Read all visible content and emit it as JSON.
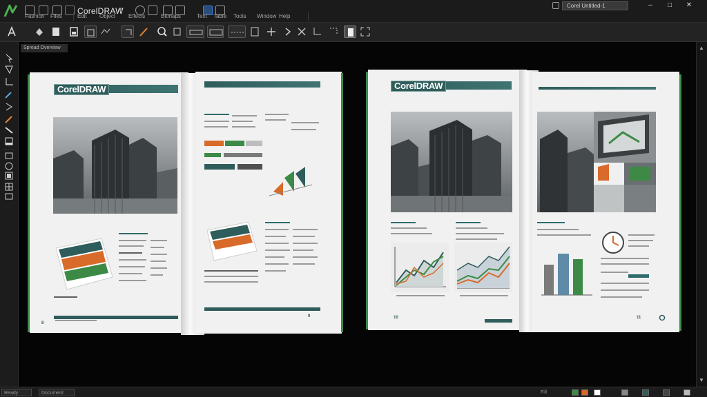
{
  "menubar": {
    "app_title": "CorelDRAW",
    "document_tab": "Corel Untitled-1",
    "menus": [
      "Fashion",
      "Files",
      "Edit",
      "Object",
      "Effects",
      "Bitmaps",
      "Text",
      "Table",
      "Tools",
      "Window",
      "Help"
    ]
  },
  "workspace": {
    "document_label": "Spread Overview"
  },
  "spreads": {
    "left": {
      "logo": "CorelDRAW",
      "page_number_left": "8",
      "page_number_right": "9"
    },
    "right": {
      "logo": "CorelDRAW",
      "page_number_left": "10",
      "page_number_right": "11"
    }
  },
  "statusbar": {
    "left_text": "Ready",
    "middle_text": "Document Info",
    "right_text": "Fill"
  },
  "colors": {
    "accent_teal": "#2f5d5c",
    "accent_green": "#3c8a46",
    "accent_orange": "#d86a2a",
    "chrome_dark": "#1b1b1b"
  },
  "icons": {
    "toolbar": [
      "new-icon",
      "open-icon",
      "save-icon",
      "print-icon",
      "cut-icon",
      "copy-icon",
      "paste-icon",
      "undo-icon",
      "redo-icon",
      "zoom-icon",
      "import-icon",
      "export-icon",
      "snap-icon",
      "align-icon",
      "transform-icon",
      "options-icon"
    ],
    "toolbox": [
      "pick-tool-icon",
      "shape-tool-icon",
      "crop-tool-icon",
      "zoom-tool-icon",
      "freehand-tool-icon",
      "artistic-media-icon",
      "rectangle-tool-icon",
      "ellipse-tool-icon",
      "polygon-tool-icon",
      "text-tool-icon",
      "table-tool-icon",
      "dimension-tool-icon",
      "connector-tool-icon",
      "eyedropper-tool-icon",
      "fill-tool-icon"
    ]
  }
}
